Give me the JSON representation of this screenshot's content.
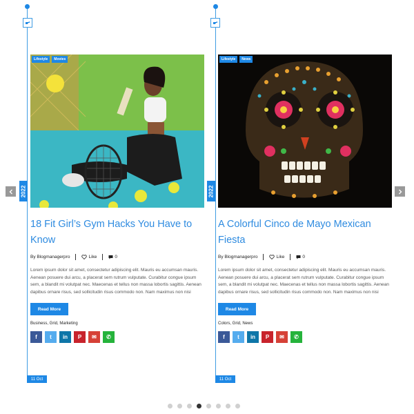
{
  "posts": [
    {
      "categories": [
        "Lifestyle",
        "Movies"
      ],
      "year": "2022",
      "title": "18 Fit Girl’s Gym Hacks You Have to Know",
      "author": "By Blogmanagerpro",
      "likes": "Like",
      "comments": "0",
      "excerpt": "Lorem ipsum dolor sit amet, consectetur adipiscing elit. Mauris eu accumsan mauris. Aenean posuere dui arcu, a placerat sem rutrum vulputate. Curabitur congue ipsum sem, a blandit mi volutpat nec. Maecenas et tellus non massa lobortis sagittis. Aenean dapibus ornare risus, sed sollicitudin risus commodo non. Nam maximus non nisi",
      "read_more": "Read More",
      "tags": "Business, Grid, Marketing",
      "date": "11 Oct"
    },
    {
      "categories": [
        "Lifestyle",
        "News"
      ],
      "year": "2022",
      "title": "A Colorful Cinco de Mayo Mexican Fiesta",
      "author": "By Blogmanagerpro",
      "likes": "Like",
      "comments": "0",
      "excerpt": "Lorem ipsum dolor sit amet, consectetur adipiscing elit. Mauris eu accumsan mauris. Aenean posuere dui arcu, a placerat sem rutrum vulputate. Curabitur congue ipsum sem, a blandit mi volutpat nec. Maecenas et tellus non massa lobortis sagittis. Aenean dapibus ornare risus, sed sollicitudin risus commodo non. Nam maximus non nisi",
      "read_more": "Read More",
      "tags": "Colors, Grid, News",
      "date": "11 Oct"
    }
  ],
  "social_icons": [
    {
      "name": "facebook-icon",
      "glyph": "f",
      "color": "#3b5998"
    },
    {
      "name": "twitter-icon",
      "glyph": "t",
      "color": "#55acee"
    },
    {
      "name": "linkedin-icon",
      "glyph": "in",
      "color": "#0e76a8"
    },
    {
      "name": "pinterest-icon",
      "glyph": "P",
      "color": "#c8232c"
    },
    {
      "name": "email-icon",
      "glyph": "✉",
      "color": "#d64137"
    },
    {
      "name": "whatsapp-icon",
      "glyph": "✆",
      "color": "#25b33b"
    }
  ],
  "pagination": {
    "total": 8,
    "active_index": 3
  },
  "colors": {
    "accent": "#1e88e5",
    "title": "#2e8be0",
    "arrow": "#999999"
  }
}
